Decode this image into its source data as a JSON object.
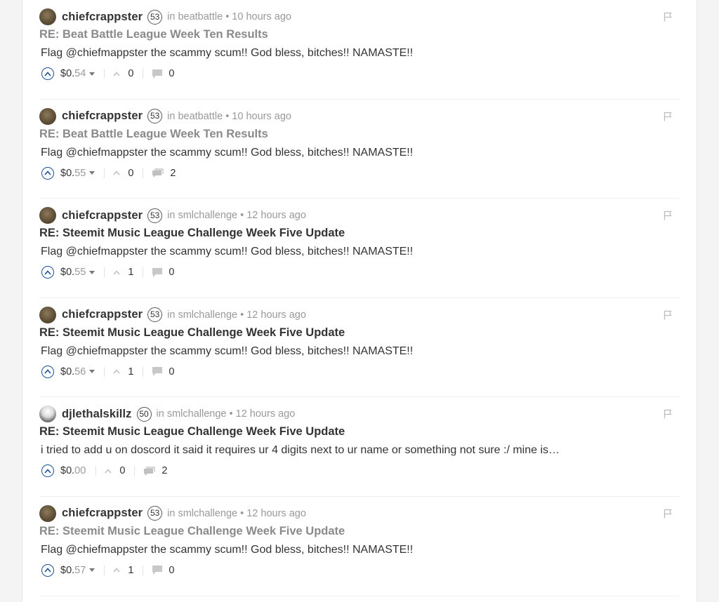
{
  "icons": {
    "avatar": "avatar-icon",
    "flag": "flag-icon",
    "upvote": "upvote-circle-icon",
    "payout_dropdown": "caret-down-icon",
    "voters": "chevron-up-icon",
    "replies": "comment-bubble-icon"
  },
  "colors": {
    "upvote": "#1a5099",
    "muted": "#999999",
    "text": "#333333"
  },
  "posts": [
    {
      "author": "chiefcrappster",
      "reputation": "53",
      "in_label": "in",
      "community": "beatbattle",
      "separator": "•",
      "time": "10 hours ago",
      "title": "RE: Beat Battle League Week Ten Results",
      "title_muted": true,
      "body": "Flag @chiefmappster the scammy scum!! God bless, bitches!! NAMASTE!!",
      "payout_dollars": "$0.",
      "payout_cents": "54",
      "has_dropdown": true,
      "votes": "0",
      "replies": "0",
      "replies_icon": "single"
    },
    {
      "author": "chiefcrappster",
      "reputation": "53",
      "in_label": "in",
      "community": "beatbattle",
      "separator": "•",
      "time": "10 hours ago",
      "title": "RE: Beat Battle League Week Ten Results",
      "title_muted": true,
      "body": "Flag @chiefmappster the scammy scum!! God bless, bitches!! NAMASTE!!",
      "payout_dollars": "$0.",
      "payout_cents": "55",
      "has_dropdown": true,
      "votes": "0",
      "replies": "2",
      "replies_icon": "multi"
    },
    {
      "author": "chiefcrappster",
      "reputation": "53",
      "in_label": "in",
      "community": "smlchallenge",
      "separator": "•",
      "time": "12 hours ago",
      "title": "RE: Steemit Music League Challenge Week Five Update",
      "title_muted": false,
      "body": "Flag @chiefmappster the scammy scum!! God bless, bitches!! NAMASTE!!",
      "payout_dollars": "$0.",
      "payout_cents": "55",
      "has_dropdown": true,
      "votes": "1",
      "replies": "0",
      "replies_icon": "single"
    },
    {
      "author": "chiefcrappster",
      "reputation": "53",
      "in_label": "in",
      "community": "smlchallenge",
      "separator": "•",
      "time": "12 hours ago",
      "title": "RE: Steemit Music League Challenge Week Five Update",
      "title_muted": false,
      "body": "Flag @chiefmappster the scammy scum!! God bless, bitches!! NAMASTE!!",
      "payout_dollars": "$0.",
      "payout_cents": "56",
      "has_dropdown": true,
      "votes": "1",
      "replies": "0",
      "replies_icon": "single"
    },
    {
      "author": "djlethalskillz",
      "reputation": "50",
      "in_label": "in",
      "community": "smlchallenge",
      "separator": "•",
      "time": "12 hours ago",
      "title": "RE: Steemit Music League Challenge Week Five Update",
      "title_muted": false,
      "body": "i tried to add u on doscord it said it requires ur 4 digits next to ur name or something not sure :/ mine is…",
      "payout_dollars": "$0.",
      "payout_cents": "00",
      "has_dropdown": false,
      "votes": "0",
      "replies": "2",
      "replies_icon": "multi"
    },
    {
      "author": "chiefcrappster",
      "reputation": "53",
      "in_label": "in",
      "community": "smlchallenge",
      "separator": "•",
      "time": "12 hours ago",
      "title": "RE: Steemit Music League Challenge Week Five Update",
      "title_muted": true,
      "body": "Flag @chiefmappster the scammy scum!! God bless, bitches!! NAMASTE!!",
      "payout_dollars": "$0.",
      "payout_cents": "57",
      "has_dropdown": true,
      "votes": "1",
      "replies": "0",
      "replies_icon": "single"
    }
  ]
}
